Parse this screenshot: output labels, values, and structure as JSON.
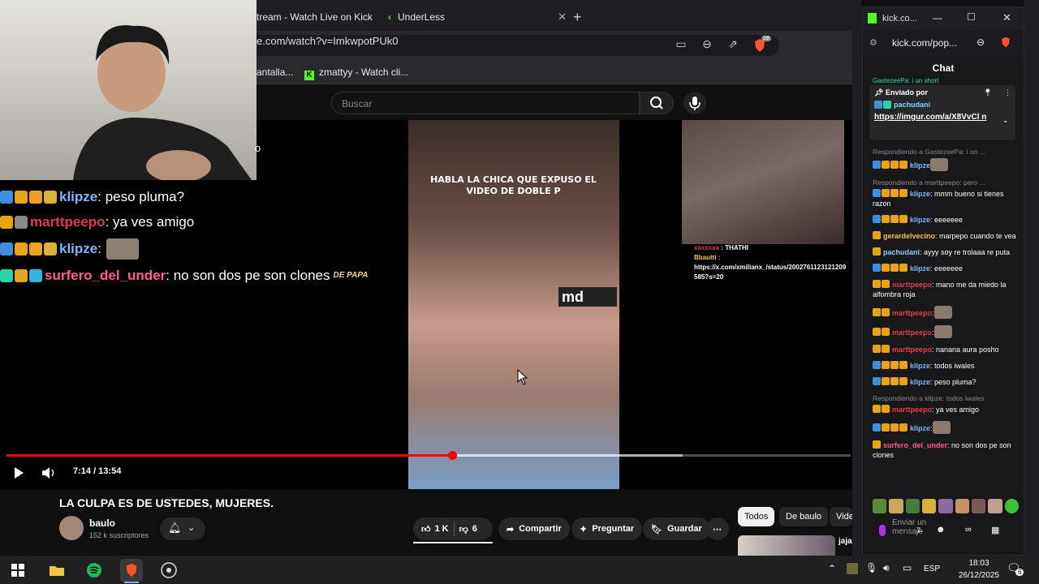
{
  "browser": {
    "tabs": [
      {
        "label": "tream - Watch Live on Kick"
      },
      {
        "label": "UnderLess"
      }
    ],
    "url": "e.com/watch?v=ImkwpotPUk0",
    "shield_count": "18",
    "bookmarks": [
      {
        "label": "antalla..."
      },
      {
        "label": "zmattyy - Watch cli..."
      }
    ]
  },
  "youtube": {
    "search_placeholder": "Buscar",
    "video": {
      "caption": "HABLA LA CHICA QUE EXPUSO EL VIDEO DE DOBLE P",
      "logo_text": "md",
      "overlay_user": "THATHI",
      "overlay_user2": "Bbautti :",
      "overlay_link": "https://x.com/xmilianx_/status/2002761123121209585?s=20",
      "webcam_partial": "o"
    },
    "progress_fraction": 0.5275,
    "time": "7:14 / 13:54",
    "title": "LA CULPA ES DE USTEDES, MUJERES.",
    "channel": "baulo",
    "subscribers": "152 k suscriptores",
    "likes": "1 K",
    "dislikes": "6",
    "share_label": "Compartir",
    "ask_label": "Preguntar",
    "save_label": "Guardar",
    "chips": [
      "Todos",
      "De baulo",
      "Vide"
    ],
    "rec_title": "jaja"
  },
  "overlay_chat": [
    {
      "user": "klipze",
      "color": "#7fb6ff",
      "text": ": peso pluma?"
    },
    {
      "user": "marttpeepo",
      "color": "#e23b50",
      "text": ": ya ves amigo"
    },
    {
      "user": "klipze",
      "color": "#7fb6ff",
      "text": ":"
    },
    {
      "user": "surfero_del_under",
      "color": "#ff5d8f",
      "text": ": no son dos pe son clones",
      "emote": "DE PAPA"
    }
  ],
  "kick": {
    "window_title": "kick.co...",
    "url": "kick.com/pop...",
    "chat_title": "Chat",
    "top_partial": "GastezeePa: i un short",
    "pinned": {
      "label": "Enviado por",
      "user": "pachudani",
      "link": "https://imgur.com/a/X8VvCl n"
    },
    "messages": [
      {
        "reply": "Respondiendo a GastezeePa: i un ...",
        "user": "klipze",
        "color": "#7fb6ff",
        "text": ""
      },
      {
        "reply": "Respondiendo a marttpeepo: pero ...",
        "user": "klipze",
        "color": "#7fb6ff",
        "text": ": mmm bueno si tienes razon"
      },
      {
        "reply": "",
        "user": "klipze",
        "color": "#7fb6ff",
        "text": ": eeeeeee"
      },
      {
        "reply": "",
        "user": "gerardelvecino",
        "color": "#f2c744",
        "text": ": marpepo cuando te vea"
      },
      {
        "reply": "",
        "user": "pachudani",
        "color": "#7fd3ff",
        "text": ": ayyy soy re trolaaa re puta"
      },
      {
        "reply": "",
        "user": "klipze",
        "color": "#7fb6ff",
        "text": ": eeeeeee"
      },
      {
        "reply": "",
        "user": "marttpeepo",
        "color": "#e23b50",
        "text": ": mano me da miedo la alfombra roja"
      },
      {
        "reply": "",
        "user": "marttpeepo",
        "color": "#e23b50",
        "text": ":"
      },
      {
        "reply": "",
        "user": "marttpeepo",
        "color": "#e23b50",
        "text": ":"
      },
      {
        "reply": "",
        "user": "marttpeepo",
        "color": "#e23b50",
        "text": ": nanana aura posho"
      },
      {
        "reply": "",
        "user": "klipze",
        "color": "#7fb6ff",
        "text": ": todos iwales"
      },
      {
        "reply": "",
        "user": "klipze",
        "color": "#7fb6ff",
        "text": ": peso pluma?"
      },
      {
        "reply": "Respondiendo a klipze: todos iwales",
        "user": "marttpeepo",
        "color": "#e23b50",
        "text": ": ya ves amigo"
      },
      {
        "reply": "",
        "user": "klipze",
        "color": "#7fb6ff",
        "text": ":"
      },
      {
        "reply": "",
        "user": "surfero_del_under",
        "color": "#ff5d8f",
        "text": ": no son dos pe son clones"
      }
    ],
    "input_placeholder": "Enviar un mensaje"
  },
  "taskbar": {
    "language": "ESP",
    "time": "18:03",
    "date": "26/12/2025",
    "notifications": "6"
  }
}
